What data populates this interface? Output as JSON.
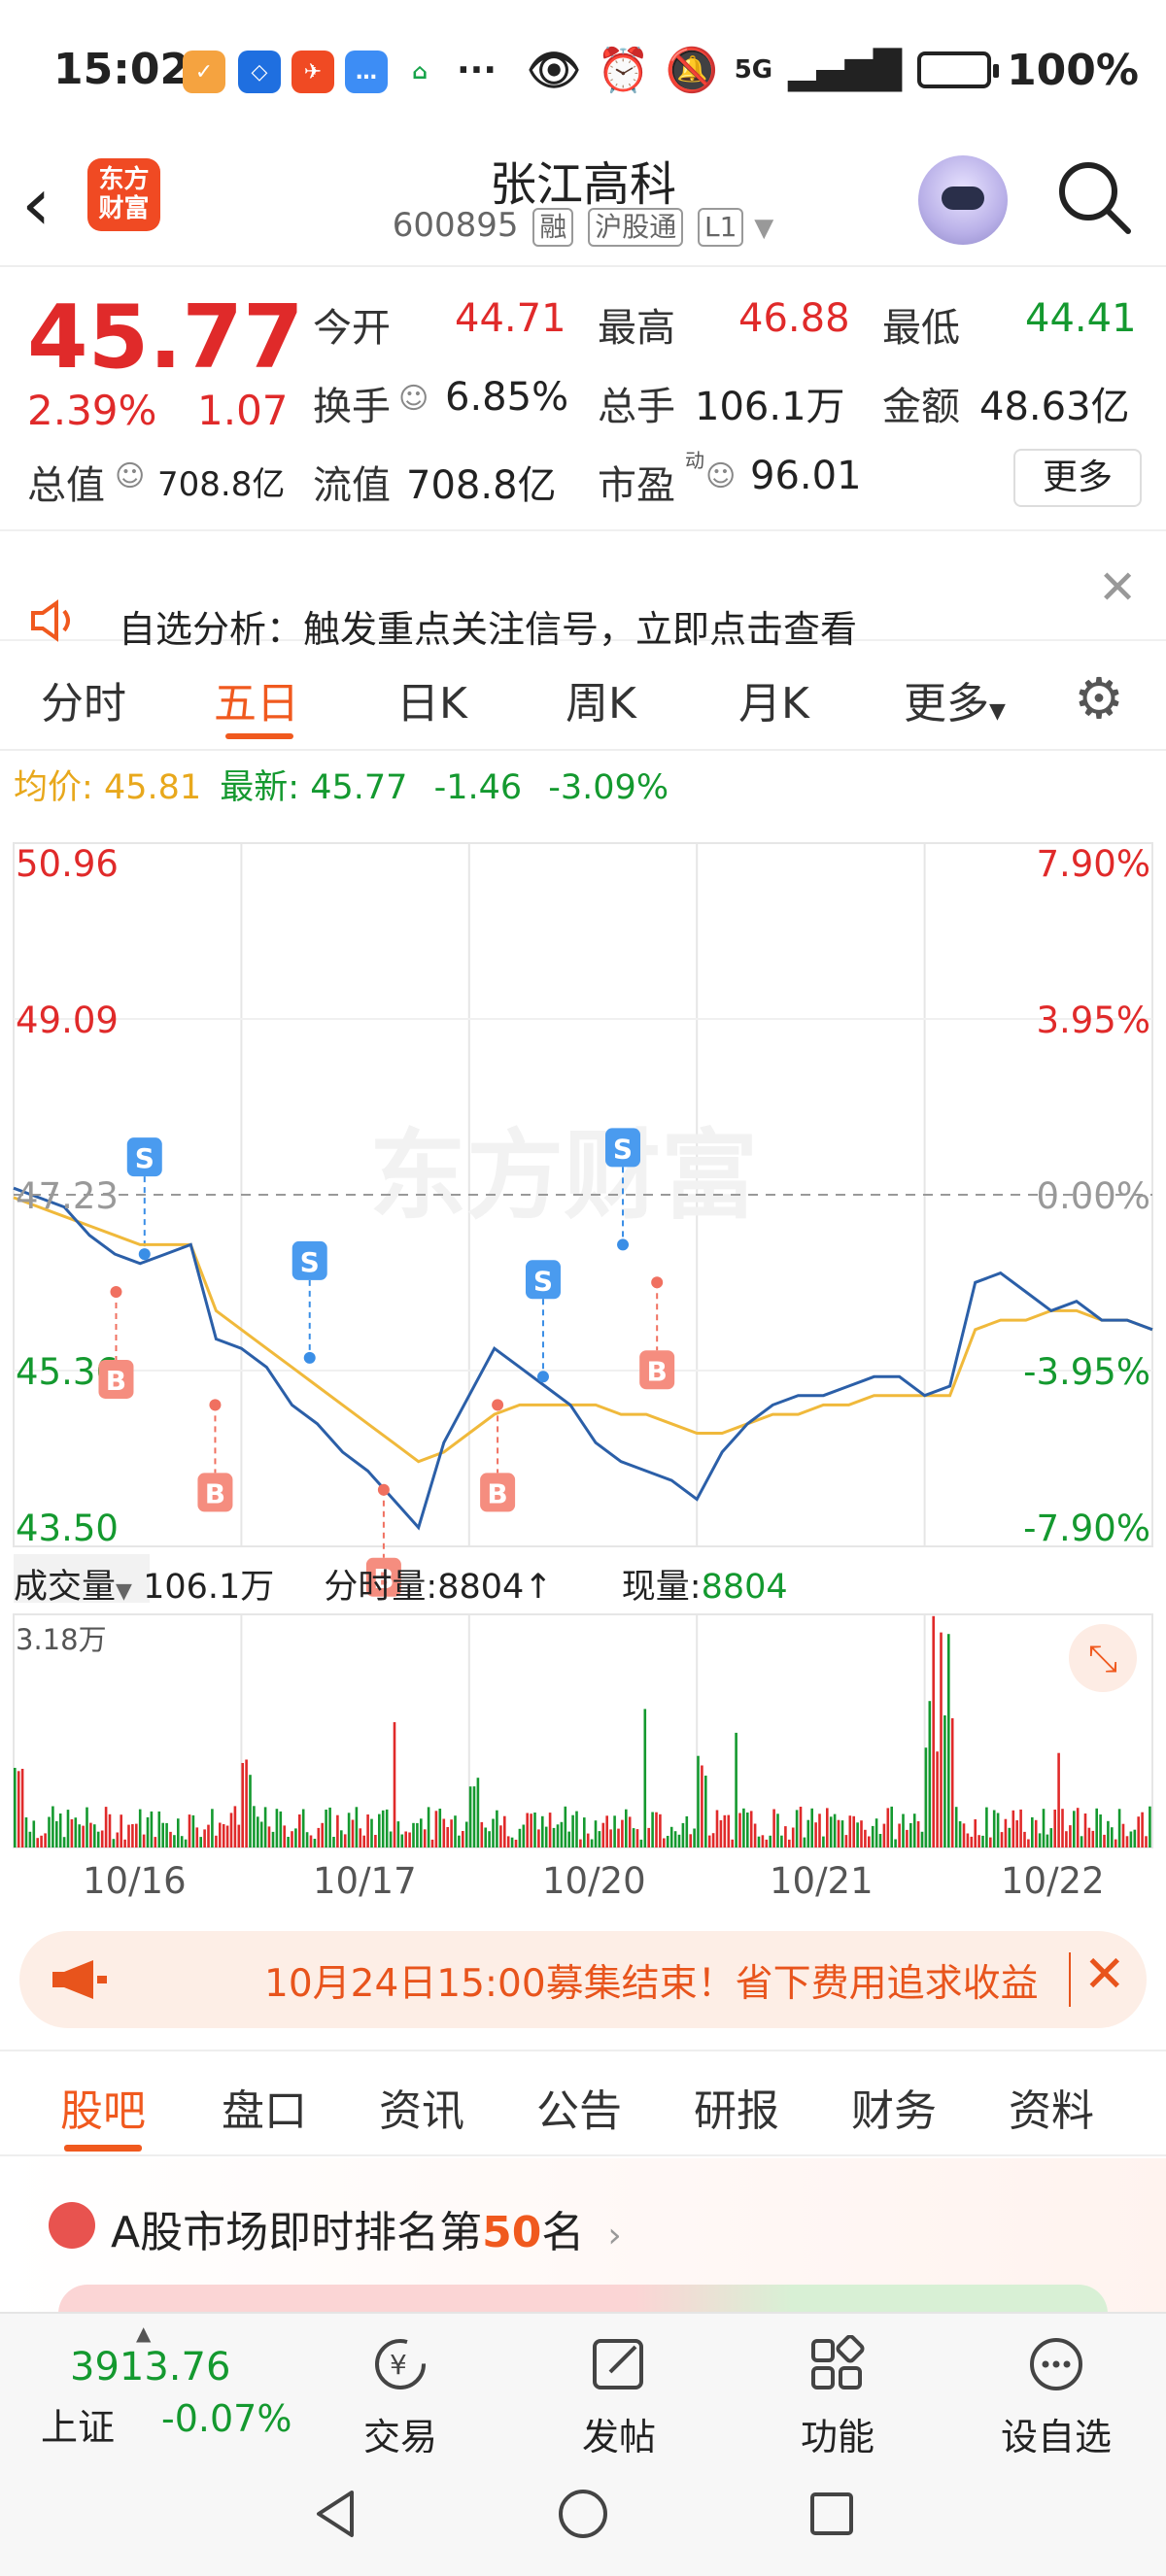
{
  "status_bar": {
    "time": "15:02",
    "network": "5G",
    "battery": "100%"
  },
  "header": {
    "app_logo": "东方财富",
    "stock_name": "张江高科",
    "stock_code": "600895",
    "tags": [
      "融",
      "沪股通",
      "L1"
    ]
  },
  "quote": {
    "price": "45.77",
    "change_pct": "2.39%",
    "change_amt": "1.07",
    "open_label": "今开",
    "open": "44.71",
    "high_label": "最高",
    "high": "46.88",
    "low_label": "最低",
    "low": "44.41",
    "turnover_label": "换手",
    "turnover": "6.85%",
    "volume_label": "总手",
    "volume": "106.1万",
    "amount_label": "金额",
    "amount": "48.63亿",
    "mktcap_label": "总值",
    "mktcap": "708.8亿",
    "float_label": "流值",
    "float_cap": "708.8亿",
    "pe_label": "市盈",
    "pe_sup": "动",
    "pe": "96.01",
    "more_button": "更多"
  },
  "notice": {
    "text": "自选分析：触发重点关注信号，立即点击查看"
  },
  "chart_tabs": [
    "分时",
    "五日",
    "日K",
    "周K",
    "月K",
    "更多"
  ],
  "price_info": {
    "avg_label": "均价:",
    "avg": "45.81",
    "latest_label": "最新:",
    "latest": "45.77",
    "diff": "-1.46",
    "diff_pct": "-3.09%"
  },
  "volume_info": {
    "label": "成交量",
    "total": "106.1万",
    "tick_label": "分时量:",
    "tick": "8804",
    "current_label": "现量:",
    "current": "8804",
    "max": "3.18万"
  },
  "watermark": "东方财富",
  "colors": {
    "up": "#e02a2a",
    "down": "#14992f",
    "accent": "#f0591e",
    "price_line": "#2b5fa8",
    "avg_line": "#f0b93b"
  },
  "chart_data": {
    "type": "line",
    "title": "",
    "x": [
      "10/16",
      "10/17",
      "10/20",
      "10/21",
      "10/22"
    ],
    "y_ticks": [
      "50.96",
      "49.09",
      "47.23",
      "45.36",
      "43.50"
    ],
    "y_pct_ticks": [
      "7.90%",
      "3.95%",
      "0.00%",
      "-3.95%",
      "-7.90%"
    ],
    "ylim": [
      43.5,
      50.96
    ],
    "prev_close": 47.23,
    "series": [
      {
        "values": [
          47.3,
          47.2,
          47.1,
          46.8,
          46.6,
          46.5,
          46.6,
          46.7,
          45.7,
          45.6,
          45.4,
          45.0,
          44.8,
          44.5,
          44.3,
          44.0,
          43.7,
          44.6,
          45.1,
          45.6,
          45.4,
          45.2,
          45.0,
          44.6,
          44.4,
          44.3,
          44.2,
          44.0,
          44.5,
          44.8,
          45.0,
          45.1,
          45.1,
          45.2,
          45.3,
          45.3,
          45.1,
          45.2,
          46.3,
          46.4,
          46.2,
          46.0,
          46.1,
          45.9,
          45.9,
          45.8
        ]
      },
      {
        "values": [
          47.2,
          47.1,
          47.0,
          46.9,
          46.8,
          46.7,
          46.7,
          46.7,
          46.0,
          45.8,
          45.6,
          45.4,
          45.2,
          45.0,
          44.8,
          44.6,
          44.4,
          44.5,
          44.7,
          44.9,
          45.0,
          45.0,
          45.0,
          45.0,
          44.9,
          44.9,
          44.8,
          44.7,
          44.7,
          44.8,
          44.9,
          44.9,
          45.0,
          45.0,
          45.1,
          45.1,
          45.1,
          45.1,
          45.8,
          45.9,
          45.9,
          46.0,
          46.0,
          45.9,
          45.9,
          45.8
        ]
      }
    ],
    "markers": [
      {
        "type": "B",
        "value": 46.2
      },
      {
        "type": "S",
        "value": 46.6
      },
      {
        "type": "B",
        "value": 45.0
      },
      {
        "type": "S",
        "value": 45.5
      },
      {
        "type": "B",
        "value": 44.1
      },
      {
        "type": "B",
        "value": 45.0
      },
      {
        "type": "S",
        "value": 45.3
      },
      {
        "type": "S",
        "value": 46.7
      },
      {
        "type": "B",
        "value": 46.3
      }
    ]
  },
  "banner": {
    "text": "10月24日15:00募集结束！省下费用追求收益"
  },
  "info_tabs": [
    "股吧",
    "盘口",
    "资讯",
    "公告",
    "研报",
    "财务",
    "资料"
  ],
  "rank": {
    "prefix": "A股市场即时排名第",
    "number": "50",
    "suffix": "名"
  },
  "toolbar": {
    "index_value": "3913.76",
    "index_name": "上证",
    "index_change": "-0.07%",
    "items": [
      "交易",
      "发帖",
      "功能",
      "设自选"
    ]
  }
}
